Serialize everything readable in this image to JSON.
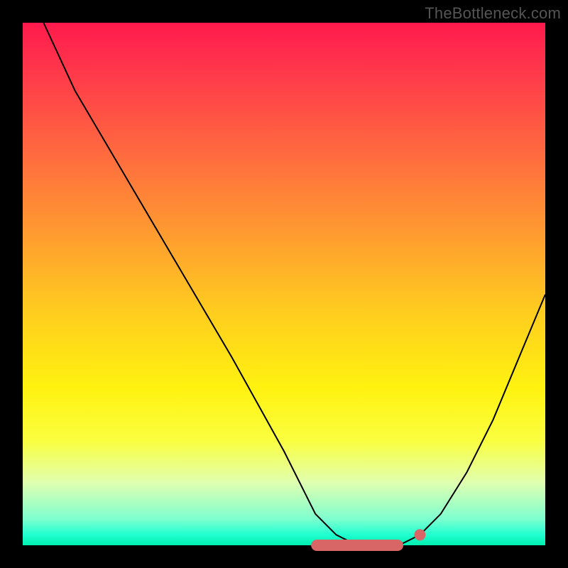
{
  "watermark": "TheBottleneck.com",
  "chart_data": {
    "type": "line",
    "title": "",
    "xlabel": "",
    "ylabel": "",
    "xlim": [
      0,
      100
    ],
    "ylim": [
      0,
      100
    ],
    "grid": false,
    "legend": false,
    "series": [
      {
        "name": "curve",
        "x": [
          4,
          10,
          20,
          30,
          40,
          50,
          56,
          60,
          64,
          68,
          72,
          76,
          80,
          85,
          90,
          95,
          100
        ],
        "y": [
          100,
          87,
          70,
          53,
          36,
          18,
          6,
          2,
          0,
          0,
          0,
          2,
          6,
          14,
          24,
          36,
          48
        ]
      }
    ],
    "markers": {
      "flat_zone": {
        "x_start": 56,
        "x_end": 72,
        "y": 0
      },
      "dot": {
        "x": 76,
        "y": 2
      }
    },
    "background_gradient": {
      "top": "#ff1a4d",
      "bottom": "#00efb0"
    },
    "colors": {
      "curve": "#000000",
      "marker": "#d86666",
      "frame": "#000000"
    }
  }
}
